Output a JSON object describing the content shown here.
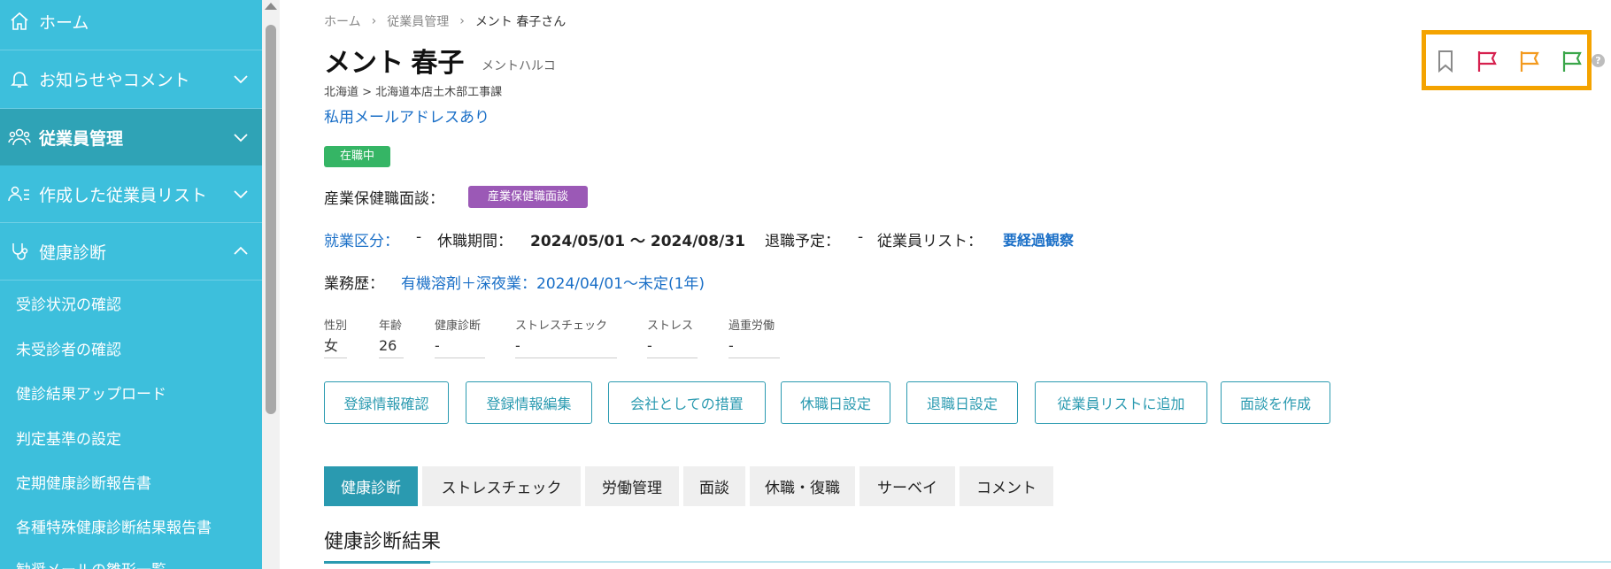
{
  "sidebar": {
    "items": [
      {
        "label": "ホーム",
        "icon": "home-icon"
      },
      {
        "label": "お知らせやコメント",
        "icon": "bell-icon"
      },
      {
        "label": "従業員管理",
        "icon": "users-icon"
      },
      {
        "label": "作成した従業員リスト",
        "icon": "user-list-icon"
      },
      {
        "label": "健康診断",
        "icon": "stethoscope-icon"
      }
    ],
    "sub_items": [
      "受診状況の確認",
      "未受診者の確認",
      "健診結果アップロード",
      "判定基準の設定",
      "定期健康診断報告書",
      "各種特殊健康診断結果報告書",
      "勧奨メールの雛形一覧"
    ]
  },
  "breadcrumb": [
    "ホーム",
    "従業員管理",
    "メント 春子さん"
  ],
  "employee": {
    "name": "メント 春子",
    "kana": "メントハルコ",
    "dept": "北海道 > 北海道本店土木部工事課",
    "mail_link": "私用メールアドレスあり",
    "status_badge": "在職中"
  },
  "interview": {
    "label": "産業保健職面談：",
    "badge": "産業保健職面談"
  },
  "employment": {
    "category_label": "就業区分：",
    "category_value": "-",
    "leave_label": "休職期間：",
    "leave_value": "2024/05/01 〜 2024/08/31",
    "retire_label": "退職予定：",
    "retire_value": "-",
    "list_label": "従業員リスト：",
    "list_value": "要経過観察"
  },
  "work_history": {
    "label": "業務歴：",
    "value": "有機溶剤＋深夜業：2024/04/01〜未定(1年)"
  },
  "stats": [
    {
      "label": "性別",
      "value": "女"
    },
    {
      "label": "年齢",
      "value": "26"
    },
    {
      "label": "健康診断",
      "value": "-"
    },
    {
      "label": "ストレスチェック",
      "value": "-"
    },
    {
      "label": "ストレス",
      "value": "-"
    },
    {
      "label": "過重労働",
      "value": "-"
    }
  ],
  "actions": [
    "登録情報確認",
    "登録情報編集",
    "会社としての措置",
    "休職日設定",
    "退職日設定",
    "従業員リストに追加",
    "面談を作成"
  ],
  "tabs": [
    "健康診断",
    "ストレスチェック",
    "労働管理",
    "面談",
    "休職・復職",
    "サーベイ",
    "コメント"
  ],
  "section_title": "健康診断結果",
  "flags": [
    {
      "icon": "bookmark-icon",
      "color": "#8a8a8a"
    },
    {
      "icon": "flag-red-icon",
      "color": "#d6204e"
    },
    {
      "icon": "flag-orange-icon",
      "color": "#f39a1e"
    },
    {
      "icon": "flag-green-icon",
      "color": "#3aa64a"
    }
  ],
  "help_glyph": "?",
  "colors": {
    "sidebar": "#3dbfdc",
    "sidebar_active": "#2fa3b6",
    "accent": "#2a9ab0",
    "link": "#1a6fc7",
    "highlight": "#f4a300",
    "status_green": "#35b565",
    "badge_purple": "#9b59b6"
  }
}
